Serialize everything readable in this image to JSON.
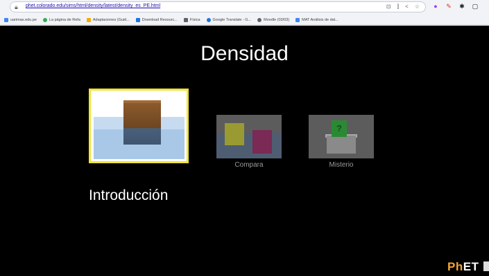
{
  "browser": {
    "url": "phet.colorado.edu/sims/html/density/latest/density_es_PE.html",
    "omni_icon": "lock-icon",
    "omni_actions": [
      "⊡",
      "⫿",
      "<",
      "☆"
    ],
    "extensions": [
      {
        "name": "extension-circle-icon",
        "glyph": "●",
        "color": "#9c3cf0"
      },
      {
        "name": "extension-pen-icon",
        "glyph": "✎",
        "color": "#d93025"
      },
      {
        "name": "extension-puzzle-icon",
        "glyph": "✱",
        "color": "#202124"
      },
      {
        "name": "window-icon",
        "glyph": "▢",
        "color": "#202124"
      }
    ]
  },
  "bookmarks": [
    {
      "label": "uarimas.edu.pe",
      "color": "#4285f4"
    },
    {
      "label": "La página de Refa",
      "color": "#34a853"
    },
    {
      "label": "Adaptaciones (Guid...",
      "color": "#f9ab00"
    },
    {
      "label": "Download Resourc...",
      "color": "#1a73e8"
    },
    {
      "label": "Física",
      "color": "#5f6368"
    },
    {
      "label": "Google Translate - G...",
      "color": "#1a73e8"
    },
    {
      "label": "Moodle (03/03)",
      "color": "#5f6368"
    },
    {
      "label": "MAT Análisis de dat...",
      "color": "#4285f4"
    }
  ],
  "sim": {
    "title": "Densidad",
    "screens": {
      "intro": "Introducción",
      "compare": "Compara",
      "mystery": "Misterio"
    },
    "mystery_mark": "?",
    "logo_ph": "Ph",
    "logo_et": "ET"
  }
}
